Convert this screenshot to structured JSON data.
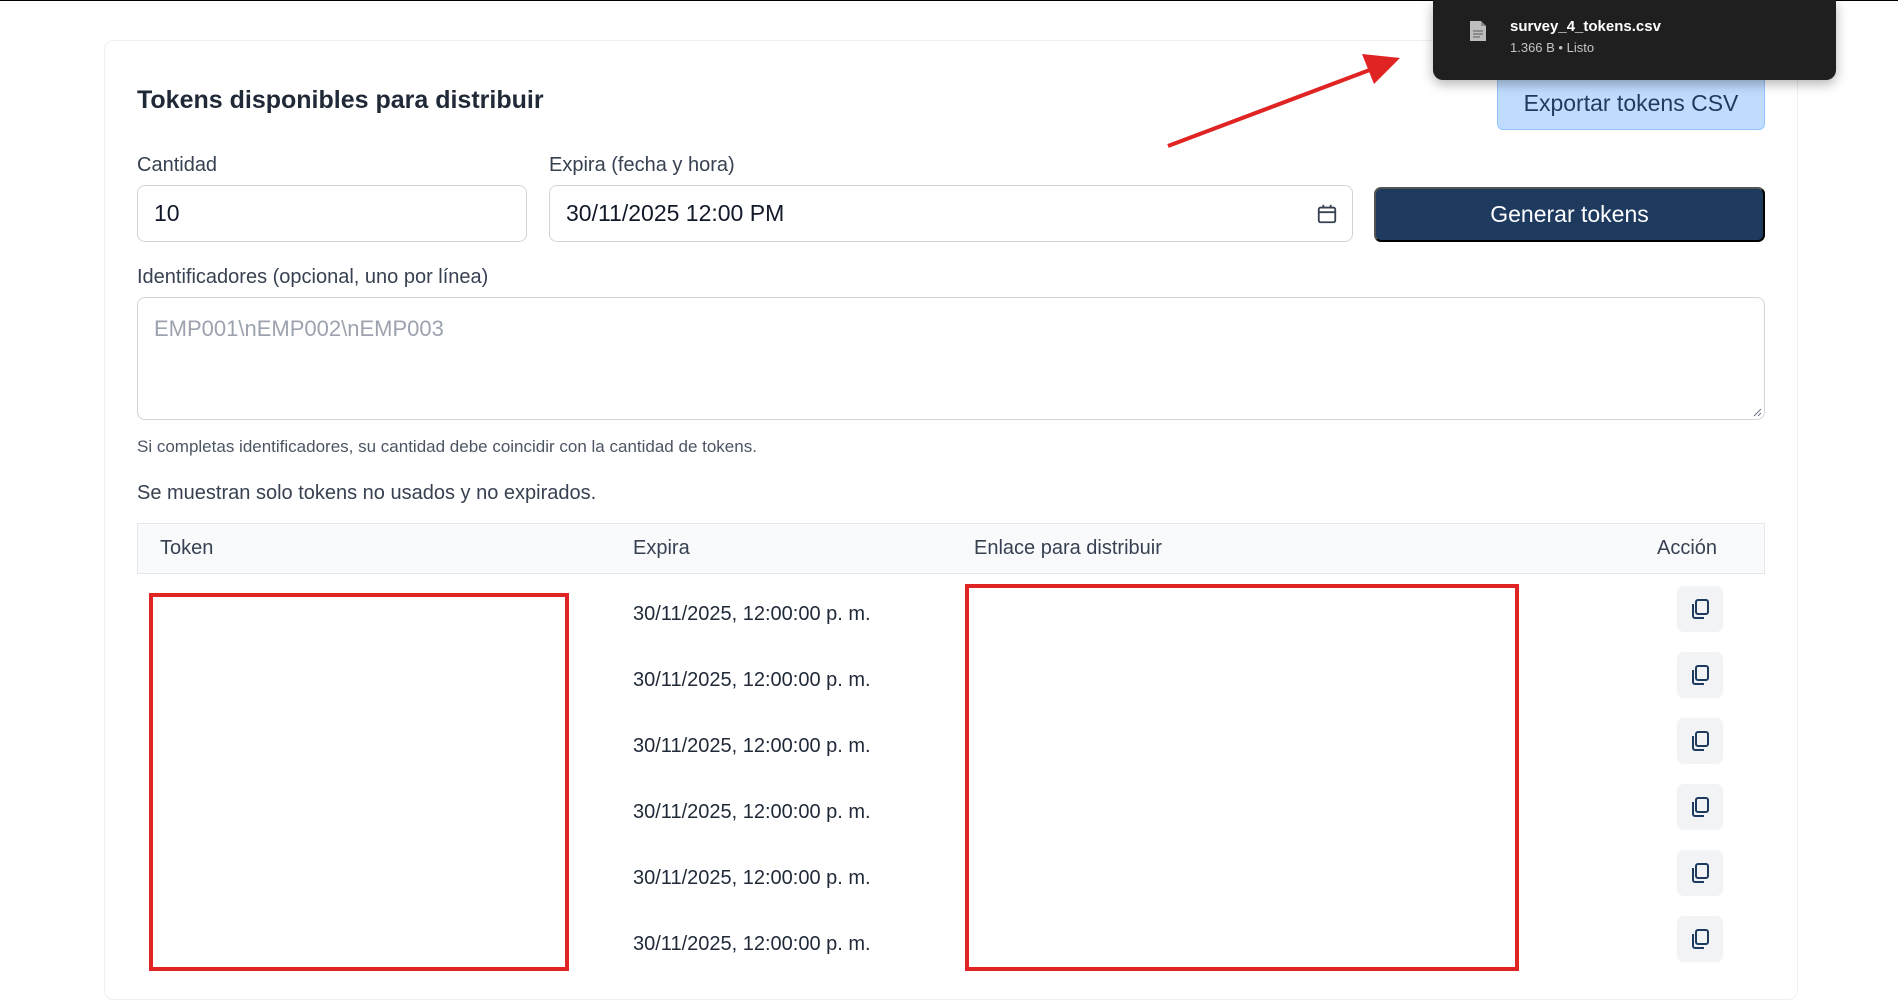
{
  "section": {
    "title": "Tokens disponibles para distribuir",
    "export_label": "Exportar tokens CSV"
  },
  "form": {
    "cantidad_label": "Cantidad",
    "cantidad_value": "10",
    "expira_label": "Expira (fecha y hora)",
    "expira_value": "30/11/2025 12:00 PM",
    "generate_label": "Generar tokens",
    "identificadores_label": "Identificadores (opcional, uno por línea)",
    "identificadores_placeholder": "EMP001\\nEMP002\\nEMP003",
    "hint": "Si completas identificadores, su cantidad debe coincidir con la cantidad de tokens."
  },
  "info_text": "Se muestran solo tokens no usados y no expirados.",
  "table": {
    "headers": [
      "Token",
      "Expira",
      "Enlace para distribuir",
      "Acción"
    ],
    "rows": [
      {
        "expira": "30/11/2025, 12:00:00 p. m."
      },
      {
        "expira": "30/11/2025, 12:00:00 p. m."
      },
      {
        "expira": "30/11/2025, 12:00:00 p. m."
      },
      {
        "expira": "30/11/2025, 12:00:00 p. m."
      },
      {
        "expira": "30/11/2025, 12:00:00 p. m."
      },
      {
        "expira": "30/11/2025, 12:00:00 p. m."
      }
    ]
  },
  "download": {
    "filename": "survey_4_tokens.csv",
    "meta": "1.366 B • Listo"
  },
  "colors": {
    "primary": "#1e3a5f",
    "export_bg": "#bfdbfe",
    "annotation_red": "#e02424"
  }
}
